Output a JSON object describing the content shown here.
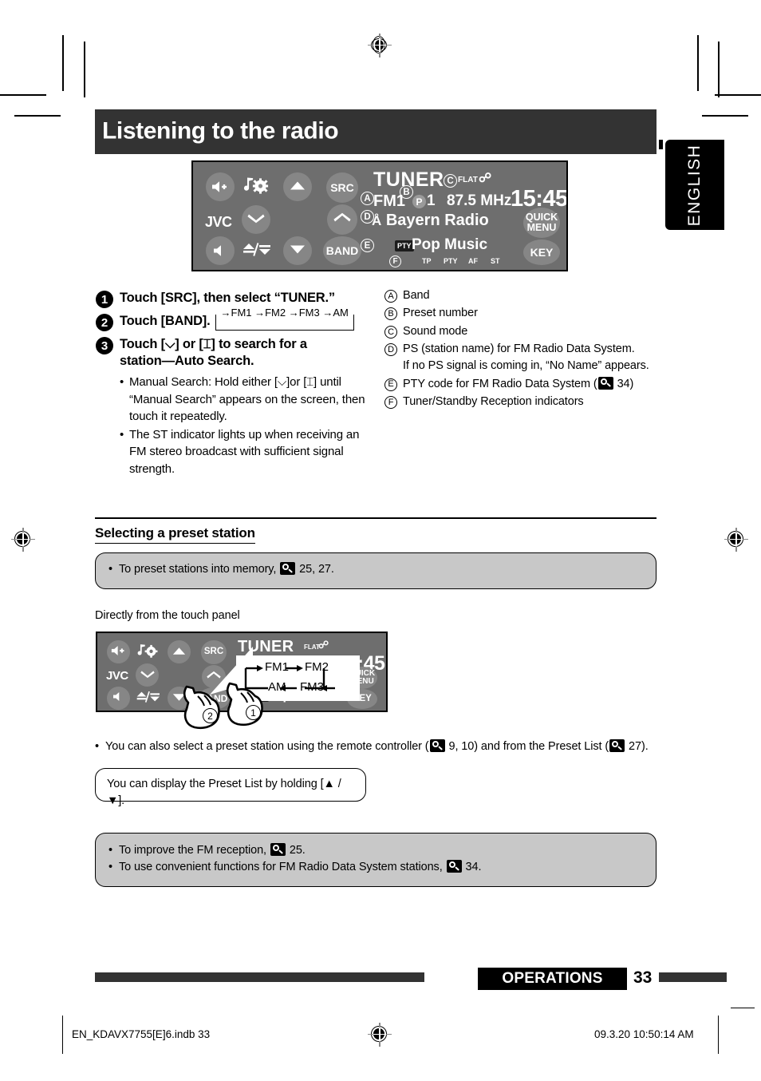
{
  "page": {
    "title": "Listening to the radio",
    "language_tab": "ENGLISH",
    "page_number": "33",
    "section_chip": "OPERATIONS"
  },
  "display_panel": {
    "brand": "JVC",
    "buttons": {
      "volume_up": "volume-up-icon",
      "sound_menu": "music-note-gear-icon",
      "scroll_up": "triangle-up-icon",
      "scroll_down": "triangle-down-icon",
      "chevron_down": "chevron-down-icon",
      "chevron_up": "chevron-up-icon",
      "volume_down": "volume-down-icon",
      "eject": "eject-tilt-icon",
      "src": "SRC",
      "band": "BAND",
      "quick_menu_line1": "QUICK",
      "quick_menu_line2": "MENU",
      "key": "KEY"
    },
    "screen": {
      "source": "TUNER",
      "sound_mode": "FLAT",
      "bluetooth": "bluetooth-icon",
      "band": "FM1",
      "preset_badge": "P",
      "preset_number": "1",
      "frequency": "87.5 MHz",
      "clock": "15:45",
      "ps_name": "Bayern Radio",
      "pty_badge": "PTY",
      "pty_name": "Pop Music",
      "indicators": [
        "TP",
        "PTY",
        "AF",
        "ST"
      ]
    },
    "callouts": [
      "A",
      "B",
      "C",
      "D",
      "E",
      "F"
    ]
  },
  "steps": [
    {
      "number": "1",
      "text": "Touch [SRC], then select “TUNER.”"
    },
    {
      "number": "2",
      "text": "Touch [BAND].",
      "chain": "→FM1 →FM2 →FM3 →AM"
    },
    {
      "number": "3",
      "line1": "Touch [⌵] or [⌶] to search for a",
      "line2": "station—Auto Search.",
      "bullets": [
        "Manual Search: Hold either [⌵]or [⌶] until “Manual Search” appears on the screen, then touch it repeatedly.",
        "The ST indicator lights up when receiving an FM stereo broadcast with sufficient signal strength."
      ]
    }
  ],
  "legend": [
    {
      "mark": "A",
      "text": "Band"
    },
    {
      "mark": "B",
      "text": "Preset number"
    },
    {
      "mark": "C",
      "text": "Sound mode"
    },
    {
      "mark": "D",
      "text": "PS (station name) for FM Radio Data System.",
      "sub": "If no PS signal is coming in, “No Name” appears."
    },
    {
      "mark": "E",
      "text_before": "PTY code for FM Radio Data System (",
      "page_ref": "34",
      "text_after": ")"
    },
    {
      "mark": "F",
      "text": "Tuner/Standby Reception indicators"
    }
  ],
  "preset_section": {
    "heading": "Selecting a preset station",
    "note_before": "To preset stations into memory,",
    "note_pages": "25, 27.",
    "subheading": "Directly from the touch panel",
    "band_loop": {
      "top_left": "FM1",
      "top_right": "FM2",
      "bottom_left": "AM",
      "bottom_right": "FM3"
    },
    "hand_labels": [
      "①",
      "②"
    ],
    "remote_note_a": "You can also select a preset station using the remote controller (",
    "remote_note_b": "9, 10) and from the Preset List (",
    "remote_note_c": "27).",
    "preset_list_tip": "You can display the Preset List by holding [▲ / ▼]."
  },
  "bottom_notes": [
    {
      "before": "To improve the FM reception,",
      "page": "25."
    },
    {
      "before": "To use convenient functions for FM Radio Data System stations,",
      "page": "34."
    }
  ],
  "footer": {
    "file_name": "EN_KDAVX7755[E]6.indb   33",
    "date": "09.3.20   10:50:14 AM"
  },
  "colors": {
    "banner": "#333333",
    "panel_body": "#6e6e6e",
    "panel_button": "#868686",
    "note_gray": "#c8c8c8",
    "black": "#000000"
  }
}
